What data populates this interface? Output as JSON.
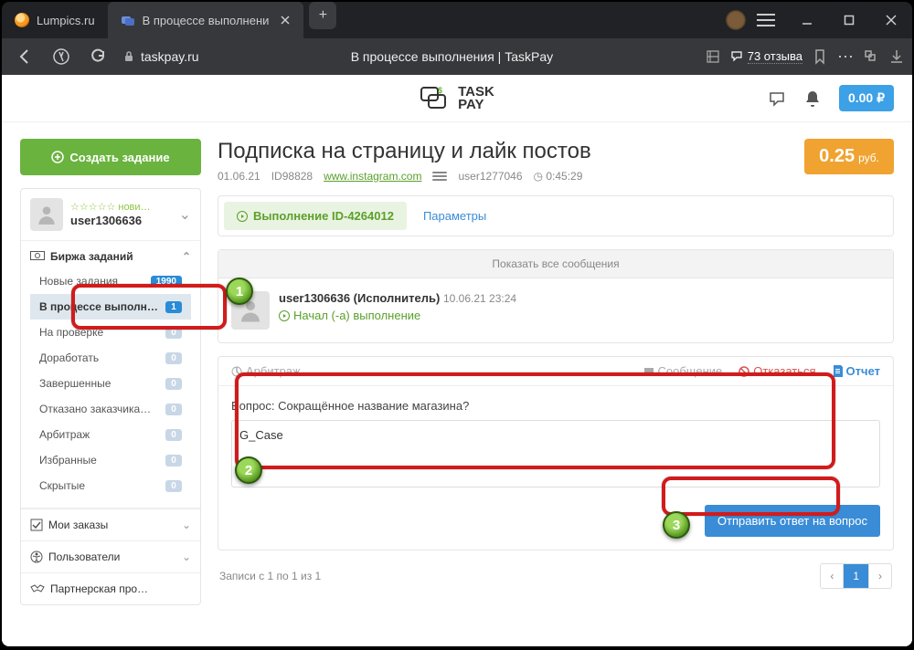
{
  "browser": {
    "tabs": [
      {
        "label": "Lumpics.ru"
      },
      {
        "label": "В процессе выполнени"
      }
    ],
    "url_host": "taskpay.ru",
    "page_title": "В процессе выполнения | TaskPay",
    "reviews": "73 отзыва"
  },
  "topbar": {
    "logo_line1": "TASK",
    "logo_line2": "PAY",
    "balance": "0.00 ₽"
  },
  "sidebar": {
    "create": "Создать задание",
    "user_level": "☆☆☆☆☆ нови…",
    "user_name": "user1306636",
    "market": "Биржа заданий",
    "items": [
      {
        "label": "Новые задания",
        "badge": "1990",
        "badgeCls": "b-blue"
      },
      {
        "label": "В процессе выполн…",
        "badge": "1",
        "badgeCls": "b-blue"
      },
      {
        "label": "На проверке",
        "badge": "0",
        "badgeCls": ""
      },
      {
        "label": "Доработать",
        "badge": "0",
        "badgeCls": ""
      },
      {
        "label": "Завершенные",
        "badge": "0",
        "badgeCls": ""
      },
      {
        "label": "Отказано заказчика…",
        "badge": "0",
        "badgeCls": ""
      },
      {
        "label": "Арбитраж",
        "badge": "0",
        "badgeCls": ""
      },
      {
        "label": "Избранные",
        "badge": "0",
        "badgeCls": ""
      },
      {
        "label": "Скрытые",
        "badge": "0",
        "badgeCls": ""
      }
    ],
    "orders": "Мои заказы",
    "users": "Пользователи",
    "partner": "Партнерская про…"
  },
  "task": {
    "title": "Подписка на страницу и лайк постов",
    "date": "01.06.21",
    "id": "ID98828",
    "link": "www.instagram.com",
    "owner": "user1277046",
    "time": "0:45:29",
    "price": "0.25",
    "price_cur": "руб.",
    "tab_exec": "Выполнение ID-4264012",
    "tab_params": "Параметры",
    "show_all": "Показать все сообщения"
  },
  "message": {
    "author": "user1306636 (Исполнитель)",
    "ts": "10.06.21 23:24",
    "action": "Начал (-а) выполнение"
  },
  "actions": {
    "arbitrage": "Арбитраж",
    "msg": "Сообщение",
    "refuse": "Отказаться",
    "report": "Отчет"
  },
  "answer": {
    "question": "Вопрос: Сокращённое название магазина?",
    "value": "G_Case",
    "submit": "Отправить ответ на вопрос"
  },
  "footer": {
    "records": "Записи с 1 по 1 из 1",
    "page": "1"
  }
}
